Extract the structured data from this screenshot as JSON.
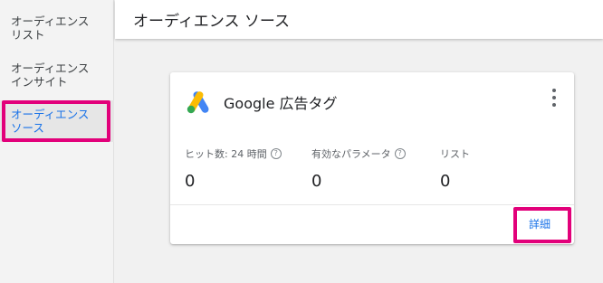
{
  "sidebar": {
    "items": [
      {
        "label_line1": "オーディエンス",
        "label_line2": "リスト"
      },
      {
        "label_line1": "オーディエンス",
        "label_line2": "インサイト"
      },
      {
        "label_line1": "オーディエンス",
        "label_line2": "ソース"
      }
    ],
    "active_index": 2
  },
  "header": {
    "title": "オーディエンス ソース"
  },
  "card": {
    "title": "Google 広告タグ",
    "logo_icon": "google-ads-logo-icon",
    "menu_icon": "more-vert-icon",
    "metrics": [
      {
        "label": "ヒット数: 24 時間",
        "value": "0",
        "help_icon": "help-circle-icon"
      },
      {
        "label": "有効なパラメータ",
        "value": "0",
        "help_icon": "help-circle-icon"
      },
      {
        "label": "リスト",
        "value": "0"
      }
    ],
    "details_label": "詳細"
  },
  "colors": {
    "accent": "#1a73e8",
    "highlight": "#e2007a",
    "ads_blue": "#4285f4",
    "ads_yellow": "#fbbc04",
    "ads_green": "#34a853"
  }
}
